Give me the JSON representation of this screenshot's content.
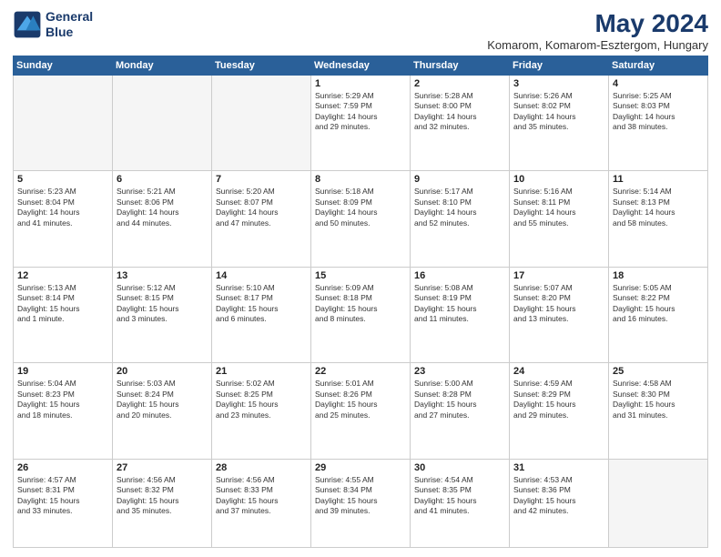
{
  "header": {
    "logo_line1": "General",
    "logo_line2": "Blue",
    "title": "May 2024",
    "subtitle": "Komarom, Komarom-Esztergom, Hungary"
  },
  "days_of_week": [
    "Sunday",
    "Monday",
    "Tuesday",
    "Wednesday",
    "Thursday",
    "Friday",
    "Saturday"
  ],
  "weeks": [
    [
      {
        "day": "",
        "info": ""
      },
      {
        "day": "",
        "info": ""
      },
      {
        "day": "",
        "info": ""
      },
      {
        "day": "1",
        "info": "Sunrise: 5:29 AM\nSunset: 7:59 PM\nDaylight: 14 hours\nand 29 minutes."
      },
      {
        "day": "2",
        "info": "Sunrise: 5:28 AM\nSunset: 8:00 PM\nDaylight: 14 hours\nand 32 minutes."
      },
      {
        "day": "3",
        "info": "Sunrise: 5:26 AM\nSunset: 8:02 PM\nDaylight: 14 hours\nand 35 minutes."
      },
      {
        "day": "4",
        "info": "Sunrise: 5:25 AM\nSunset: 8:03 PM\nDaylight: 14 hours\nand 38 minutes."
      }
    ],
    [
      {
        "day": "5",
        "info": "Sunrise: 5:23 AM\nSunset: 8:04 PM\nDaylight: 14 hours\nand 41 minutes."
      },
      {
        "day": "6",
        "info": "Sunrise: 5:21 AM\nSunset: 8:06 PM\nDaylight: 14 hours\nand 44 minutes."
      },
      {
        "day": "7",
        "info": "Sunrise: 5:20 AM\nSunset: 8:07 PM\nDaylight: 14 hours\nand 47 minutes."
      },
      {
        "day": "8",
        "info": "Sunrise: 5:18 AM\nSunset: 8:09 PM\nDaylight: 14 hours\nand 50 minutes."
      },
      {
        "day": "9",
        "info": "Sunrise: 5:17 AM\nSunset: 8:10 PM\nDaylight: 14 hours\nand 52 minutes."
      },
      {
        "day": "10",
        "info": "Sunrise: 5:16 AM\nSunset: 8:11 PM\nDaylight: 14 hours\nand 55 minutes."
      },
      {
        "day": "11",
        "info": "Sunrise: 5:14 AM\nSunset: 8:13 PM\nDaylight: 14 hours\nand 58 minutes."
      }
    ],
    [
      {
        "day": "12",
        "info": "Sunrise: 5:13 AM\nSunset: 8:14 PM\nDaylight: 15 hours\nand 1 minute."
      },
      {
        "day": "13",
        "info": "Sunrise: 5:12 AM\nSunset: 8:15 PM\nDaylight: 15 hours\nand 3 minutes."
      },
      {
        "day": "14",
        "info": "Sunrise: 5:10 AM\nSunset: 8:17 PM\nDaylight: 15 hours\nand 6 minutes."
      },
      {
        "day": "15",
        "info": "Sunrise: 5:09 AM\nSunset: 8:18 PM\nDaylight: 15 hours\nand 8 minutes."
      },
      {
        "day": "16",
        "info": "Sunrise: 5:08 AM\nSunset: 8:19 PM\nDaylight: 15 hours\nand 11 minutes."
      },
      {
        "day": "17",
        "info": "Sunrise: 5:07 AM\nSunset: 8:20 PM\nDaylight: 15 hours\nand 13 minutes."
      },
      {
        "day": "18",
        "info": "Sunrise: 5:05 AM\nSunset: 8:22 PM\nDaylight: 15 hours\nand 16 minutes."
      }
    ],
    [
      {
        "day": "19",
        "info": "Sunrise: 5:04 AM\nSunset: 8:23 PM\nDaylight: 15 hours\nand 18 minutes."
      },
      {
        "day": "20",
        "info": "Sunrise: 5:03 AM\nSunset: 8:24 PM\nDaylight: 15 hours\nand 20 minutes."
      },
      {
        "day": "21",
        "info": "Sunrise: 5:02 AM\nSunset: 8:25 PM\nDaylight: 15 hours\nand 23 minutes."
      },
      {
        "day": "22",
        "info": "Sunrise: 5:01 AM\nSunset: 8:26 PM\nDaylight: 15 hours\nand 25 minutes."
      },
      {
        "day": "23",
        "info": "Sunrise: 5:00 AM\nSunset: 8:28 PM\nDaylight: 15 hours\nand 27 minutes."
      },
      {
        "day": "24",
        "info": "Sunrise: 4:59 AM\nSunset: 8:29 PM\nDaylight: 15 hours\nand 29 minutes."
      },
      {
        "day": "25",
        "info": "Sunrise: 4:58 AM\nSunset: 8:30 PM\nDaylight: 15 hours\nand 31 minutes."
      }
    ],
    [
      {
        "day": "26",
        "info": "Sunrise: 4:57 AM\nSunset: 8:31 PM\nDaylight: 15 hours\nand 33 minutes."
      },
      {
        "day": "27",
        "info": "Sunrise: 4:56 AM\nSunset: 8:32 PM\nDaylight: 15 hours\nand 35 minutes."
      },
      {
        "day": "28",
        "info": "Sunrise: 4:56 AM\nSunset: 8:33 PM\nDaylight: 15 hours\nand 37 minutes."
      },
      {
        "day": "29",
        "info": "Sunrise: 4:55 AM\nSunset: 8:34 PM\nDaylight: 15 hours\nand 39 minutes."
      },
      {
        "day": "30",
        "info": "Sunrise: 4:54 AM\nSunset: 8:35 PM\nDaylight: 15 hours\nand 41 minutes."
      },
      {
        "day": "31",
        "info": "Sunrise: 4:53 AM\nSunset: 8:36 PM\nDaylight: 15 hours\nand 42 minutes."
      },
      {
        "day": "",
        "info": ""
      }
    ]
  ]
}
